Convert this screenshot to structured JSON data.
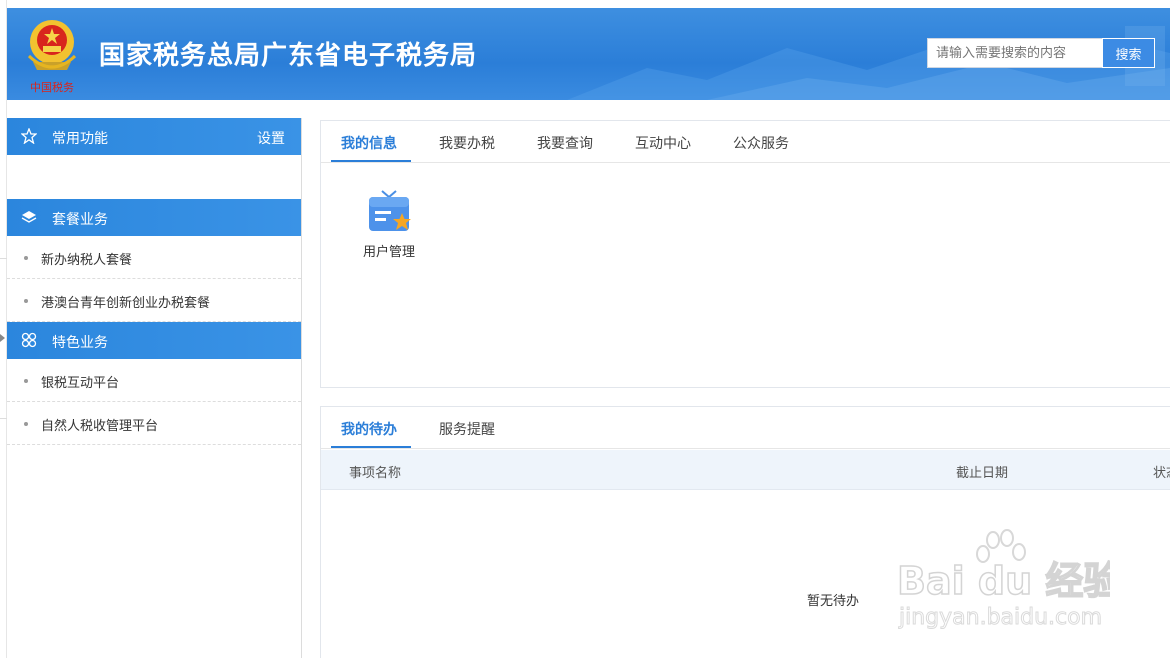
{
  "header": {
    "site_title": "国家税务总局广东省电子税务局",
    "search_placeholder": "请输入需要搜索的内容",
    "search_button": "搜索",
    "emblem_text": "中国税务"
  },
  "sidebar": {
    "favorites": {
      "label": "常用功能",
      "action": "设置"
    },
    "packages": {
      "label": "套餐业务",
      "items": [
        "新办纳税人套餐",
        "港澳台青年创新创业办税套餐"
      ]
    },
    "featured": {
      "label": "特色业务",
      "items": [
        "银税互动平台",
        "自然人税收管理平台"
      ]
    }
  },
  "main_tabs": [
    "我的信息",
    "我要办税",
    "我要查询",
    "互动中心",
    "公众服务"
  ],
  "info_tiles": [
    {
      "label": "用户管理",
      "icon": "user-management-icon"
    }
  ],
  "todo": {
    "tabs": [
      "我的待办",
      "服务提醒"
    ],
    "columns": [
      "事项名称",
      "截止日期",
      "状态"
    ],
    "empty_text": "暂无待办"
  },
  "watermark": {
    "line1": "Bai du 经验",
    "line2": "jingyan.baidu.com"
  },
  "colors": {
    "primary": "#2b7ed8",
    "header_bg": "#3a8be0",
    "table_head": "#eef4fb"
  }
}
